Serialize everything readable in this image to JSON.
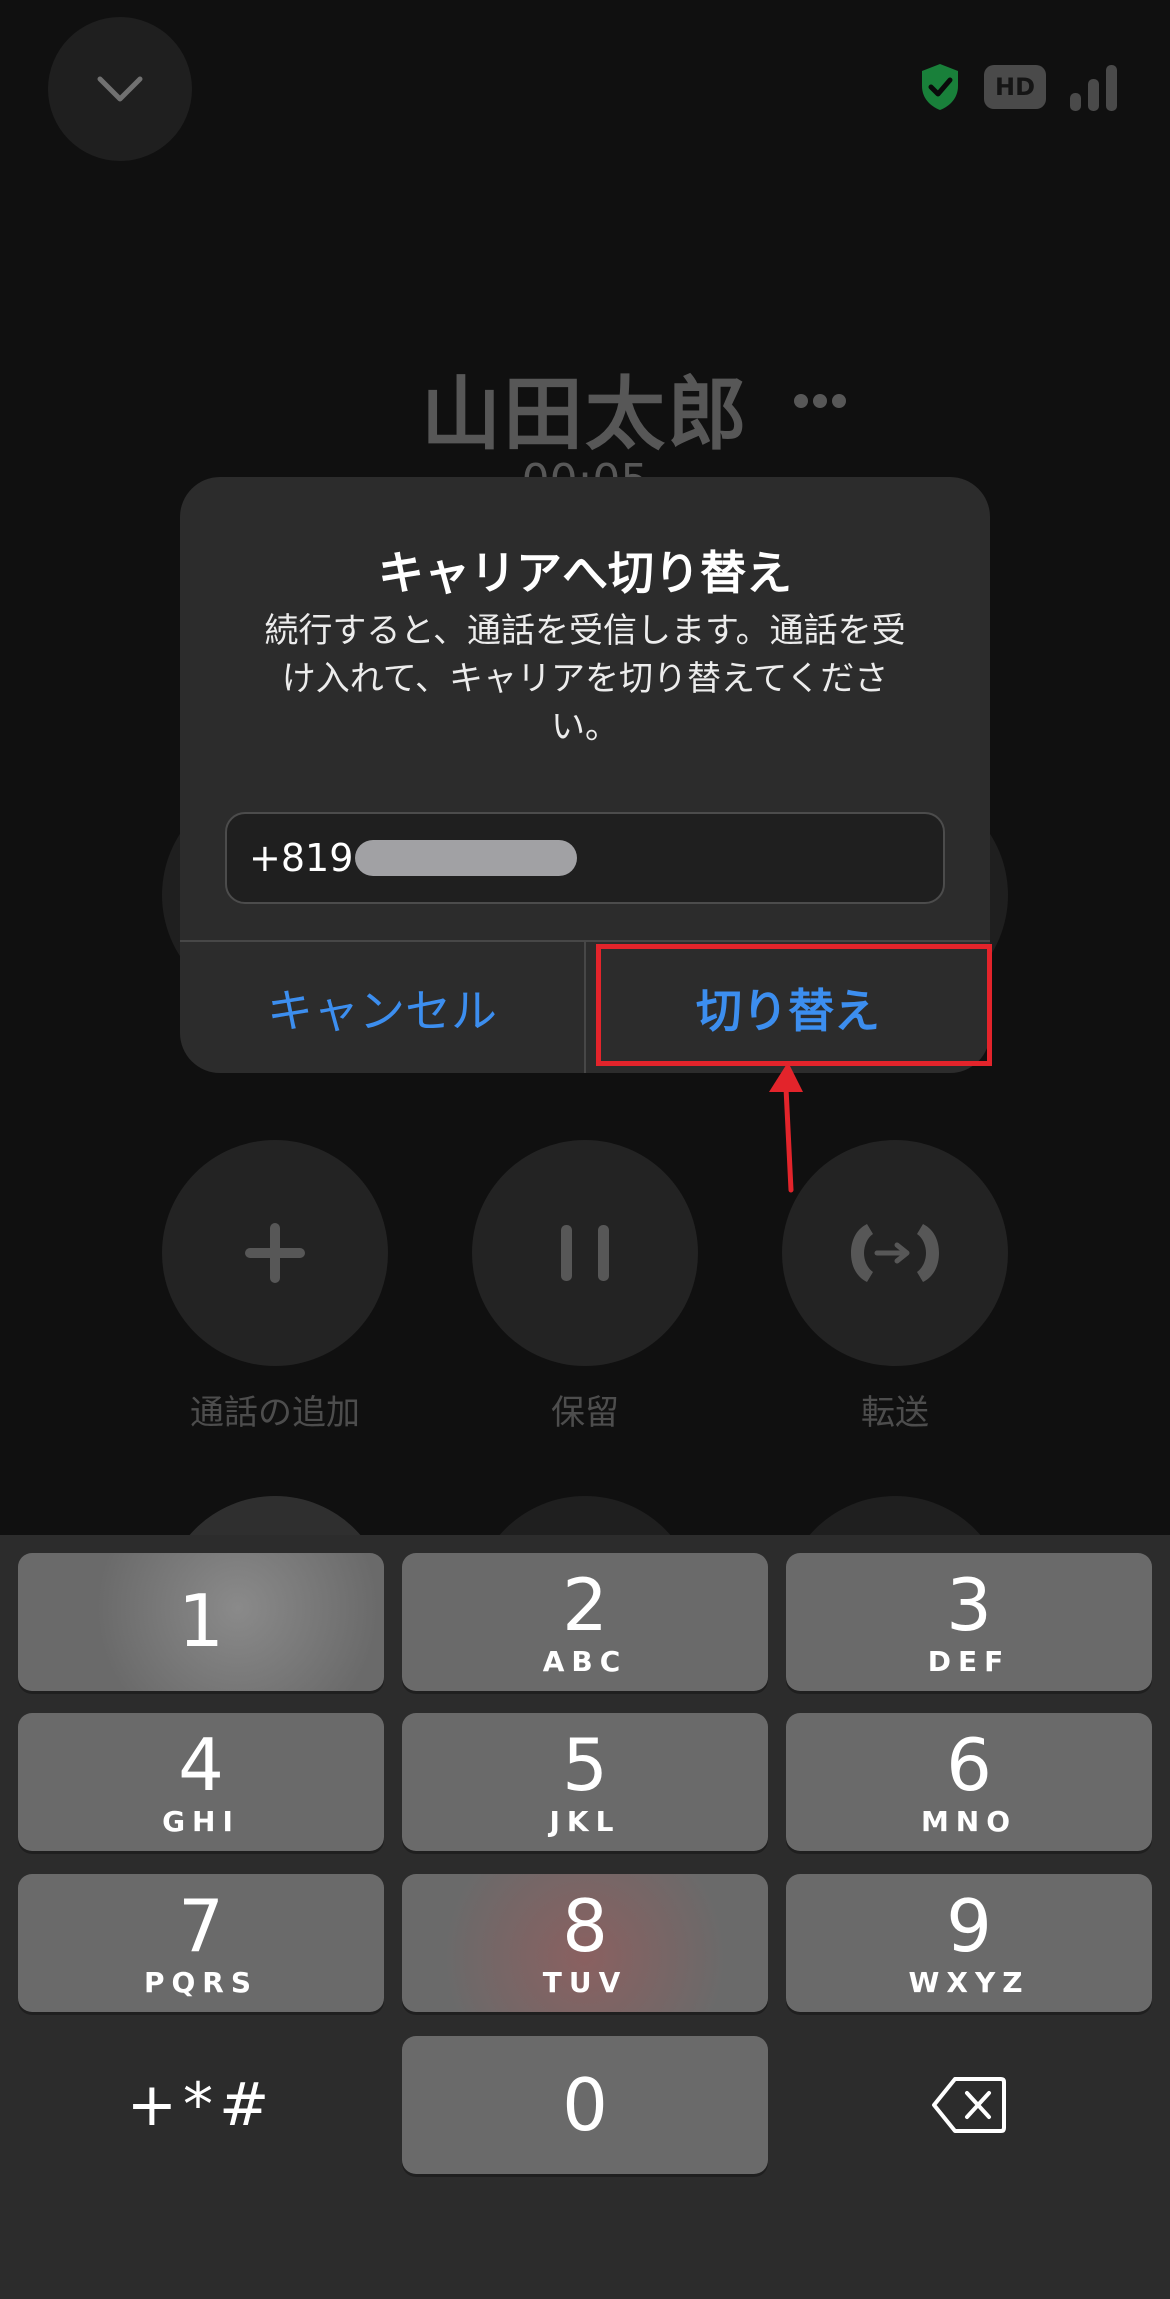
{
  "call": {
    "caller_name": "山田太郎",
    "timer": "00:05"
  },
  "status": {
    "hd_label": "HD",
    "shield_color": "#1f9d47"
  },
  "actions": [
    {
      "label": "通話の追加",
      "icon": "plus-icon"
    },
    {
      "label": "保留",
      "icon": "pause-icon"
    },
    {
      "label": "転送",
      "icon": "transfer-icon"
    }
  ],
  "dialog": {
    "title": "キャリアへ切り替え",
    "message": "続行すると、通話を受信します。通話を受け入れて、キャリアを切り替えてください。",
    "input_value": "+819",
    "cancel_label": "キャンセル",
    "confirm_label": "切り替え",
    "accent_color": "#3c8eef"
  },
  "annotation": {
    "color": "#e3242b"
  },
  "keypad": {
    "keys": [
      {
        "digit": "1",
        "letters": ""
      },
      {
        "digit": "2",
        "letters": "ABC"
      },
      {
        "digit": "3",
        "letters": "DEF"
      },
      {
        "digit": "4",
        "letters": "GHI"
      },
      {
        "digit": "5",
        "letters": "JKL"
      },
      {
        "digit": "6",
        "letters": "MNO"
      },
      {
        "digit": "7",
        "letters": "PQRS"
      },
      {
        "digit": "8",
        "letters": "TUV"
      },
      {
        "digit": "9",
        "letters": "WXYZ"
      },
      {
        "digit": "0",
        "letters": ""
      }
    ],
    "symbols": "+*#"
  }
}
